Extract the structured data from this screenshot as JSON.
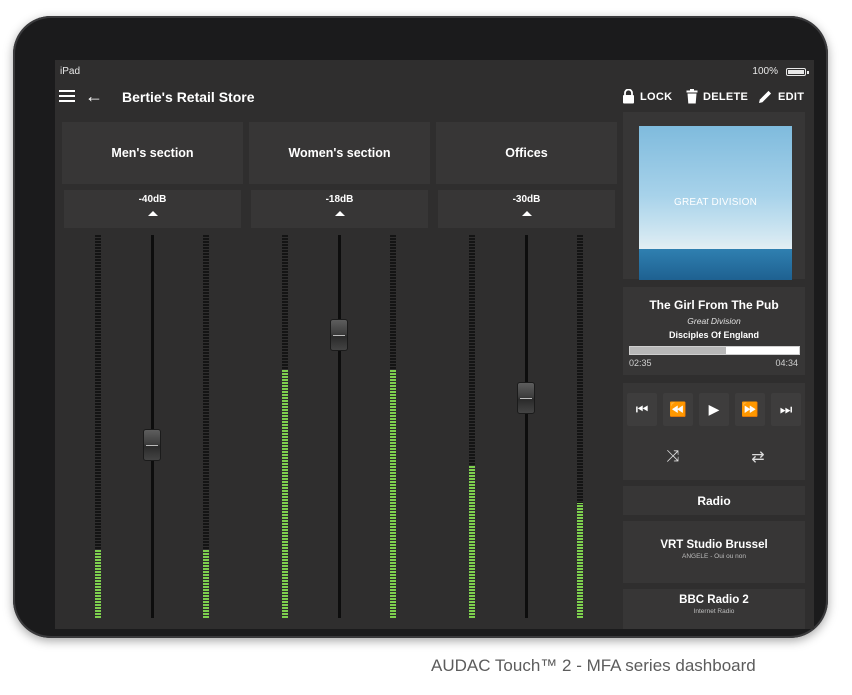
{
  "status_bar": {
    "device": "iPad",
    "battery": "100%"
  },
  "topbar": {
    "title": "Bertie's Retail Store",
    "lock_label": "LOCK",
    "delete_label": "DELETE",
    "edit_label": "EDIT"
  },
  "icons": {
    "menu": "hamburger-icon",
    "back": "arrow-left-icon",
    "lock": "lock-icon",
    "delete": "trash-icon",
    "edit": "pencil-icon"
  },
  "zones": [
    {
      "name": "Men's section",
      "volume": "-40dB",
      "left_level": 0.18,
      "right_level": 0.18
    },
    {
      "name": "Women's section",
      "volume": "-18dB",
      "left_level": 0.65,
      "right_level": 0.65
    },
    {
      "name": "Offices",
      "volume": "-30dB",
      "left_level": 0.4,
      "right_level": 0.3
    }
  ],
  "player": {
    "album_art_text": "GREAT DIVISION",
    "title": "The Girl From The Pub",
    "artist": "Great Division",
    "album": "Disciples Of England",
    "elapsed": "02:35",
    "total": "04:34",
    "progress": 0.57,
    "controls": {
      "previous": "⏮",
      "rewind": "⏪",
      "play": "▶",
      "forward": "⏩",
      "next": "⏭"
    },
    "shuffle_icon": "⤨",
    "repeat_icon": "⇄"
  },
  "radio": {
    "header": "Radio",
    "stations": [
      {
        "name": "VRT Studio Brussel",
        "subtitle": "ANGELE - Oui ou non"
      },
      {
        "name": "BBC Radio 2",
        "subtitle": "Internet Radio"
      }
    ]
  },
  "accent_colors": {
    "meter_green": "#7ed04e",
    "background": "#2f2e2e",
    "panel": "#373636"
  },
  "caption": "AUDAC Touch™ 2 - MFA series dashboard"
}
